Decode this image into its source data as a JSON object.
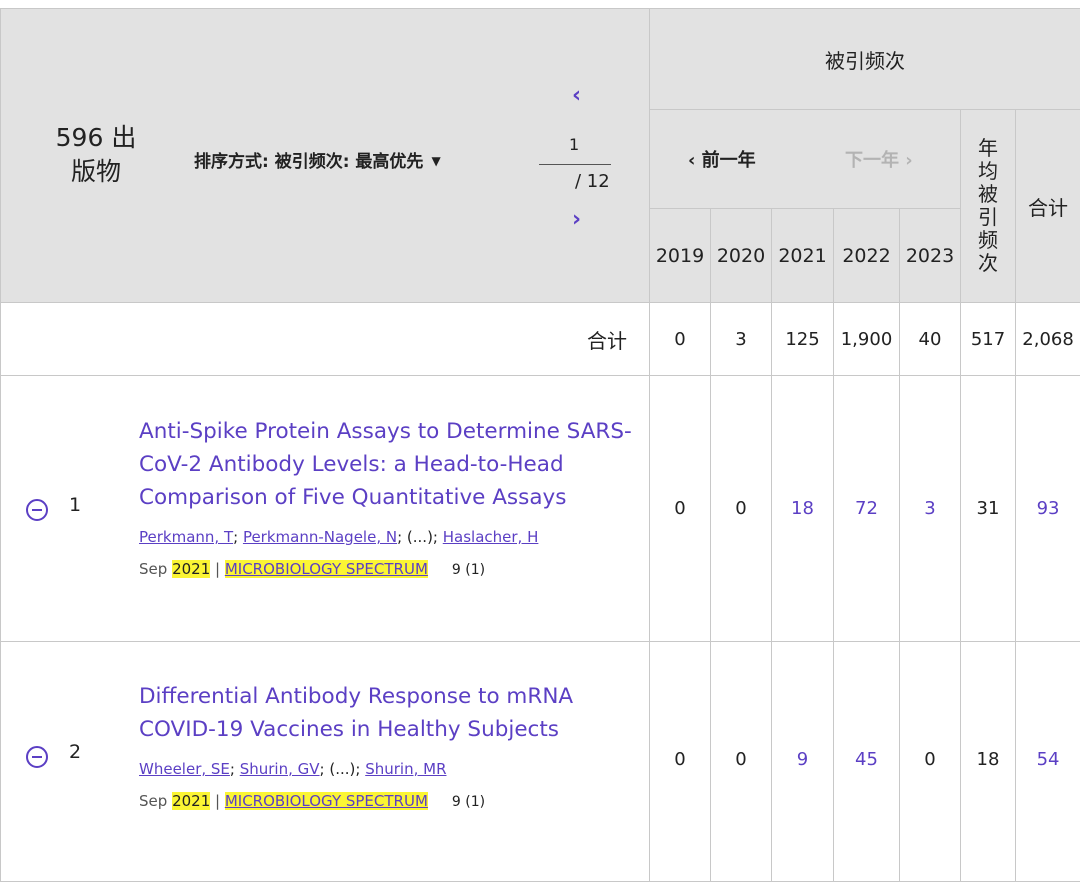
{
  "header": {
    "publication_count_line1": "596 出",
    "publication_count_line2": "版物",
    "sort_label": "排序方式: 被引频次: 最高优先",
    "pager": {
      "prev_symbol": "‹",
      "current_page": "1",
      "total_pages": "/ 12",
      "next_symbol": "›"
    },
    "times_cited_label": "被引频次",
    "prev_year_label": "‹ 前一年",
    "next_year_label": "下一年 ›",
    "years": [
      "2019",
      "2020",
      "2021",
      "2022",
      "2023"
    ],
    "avg_per_year_label": [
      "年",
      "均",
      "被",
      "引",
      "频",
      "次"
    ],
    "total_label": "合计"
  },
  "totals": {
    "label": "合计",
    "values": [
      "0",
      "3",
      "125",
      "1,900",
      "40"
    ],
    "avg": "517",
    "total": "2,068"
  },
  "publications": [
    {
      "rank": "1",
      "title_lines": [
        "Anti-Spike Protein Assays to Determine SARS-",
        "CoV-2 Antibody Levels: a Head-to-Head",
        "Comparison of Five Quantitative Assays"
      ],
      "authors": [
        "Perkmann, T",
        "Perkmann-Nagele, N",
        "Haslacher, H"
      ],
      "author_ellipsis": "(...)",
      "month": "Sep",
      "year": "2021",
      "journal": "MICROBIOLOGY SPECTRUM",
      "volume": "9 (1)",
      "citations": [
        "0",
        "0",
        "18",
        "72",
        "3"
      ],
      "avg": "31",
      "total": "93"
    },
    {
      "rank": "2",
      "title_lines": [
        "Differential Antibody Response to mRNA",
        "COVID-19 Vaccines in Healthy Subjects"
      ],
      "authors": [
        "Wheeler, SE",
        "Shurin, GV",
        "Shurin, MR"
      ],
      "author_ellipsis": "(...)",
      "month": "Sep",
      "year": "2021",
      "journal": "MICROBIOLOGY SPECTRUM",
      "volume": "9 (1)",
      "citations": [
        "0",
        "0",
        "9",
        "45",
        "0"
      ],
      "avg": "18",
      "total": "54"
    }
  ],
  "colors": {
    "link": "#5b3fc4",
    "highlight": "#fbf534",
    "header_bg": "#e2e2e2"
  }
}
